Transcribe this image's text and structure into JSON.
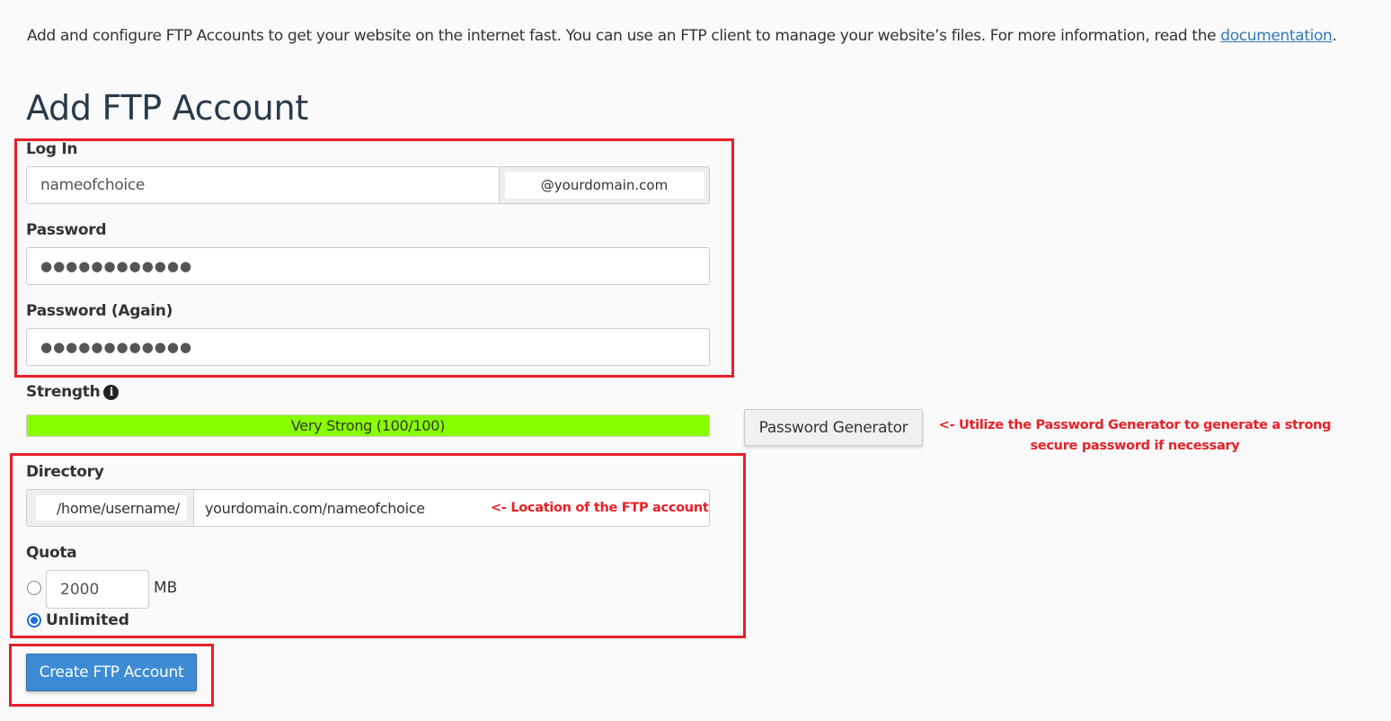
{
  "intro": {
    "text": "Add and configure FTP Accounts to get your website on the internet fast. You can use an FTP client to manage your website’s files. For more information, read the ",
    "link_label": "documentation",
    "suffix": "."
  },
  "page_title": "Add FTP Account",
  "form": {
    "login": {
      "label": "Log In",
      "value": "nameofchoice",
      "domain_suffix": "@yourdomain.com"
    },
    "password": {
      "label": "Password",
      "masked_value": "●●●●●●●●●●●●"
    },
    "password_again": {
      "label": "Password (Again)",
      "masked_value": "●●●●●●●●●●●●"
    },
    "strength": {
      "label": "Strength",
      "info_icon": "info-circle-icon",
      "text": "Very Strong (100/100)",
      "score_percent": 100,
      "bar_color": "#88ff00"
    },
    "password_generator_label": "Password Generator",
    "directory": {
      "label": "Directory",
      "prefix": "/home/username/",
      "value": "yourdomain.com/nameofchoice"
    },
    "quota": {
      "label": "Quota",
      "value": "2000",
      "unit": "MB",
      "unlimited_label": "Unlimited",
      "selected": "unlimited"
    },
    "submit_label": "Create FTP Account"
  },
  "annotations": {
    "password_generator_note_line1": "<- Utilize the Password Generator to generate a strong",
    "password_generator_note_line2": "secure password if necessary",
    "directory_note": "<- Location of the FTP account",
    "highlight_color": "#e8202a"
  },
  "colors": {
    "primary_button": "#3d8bd4",
    "link": "#337ab7",
    "radio_selected": "#1a6fd8"
  }
}
